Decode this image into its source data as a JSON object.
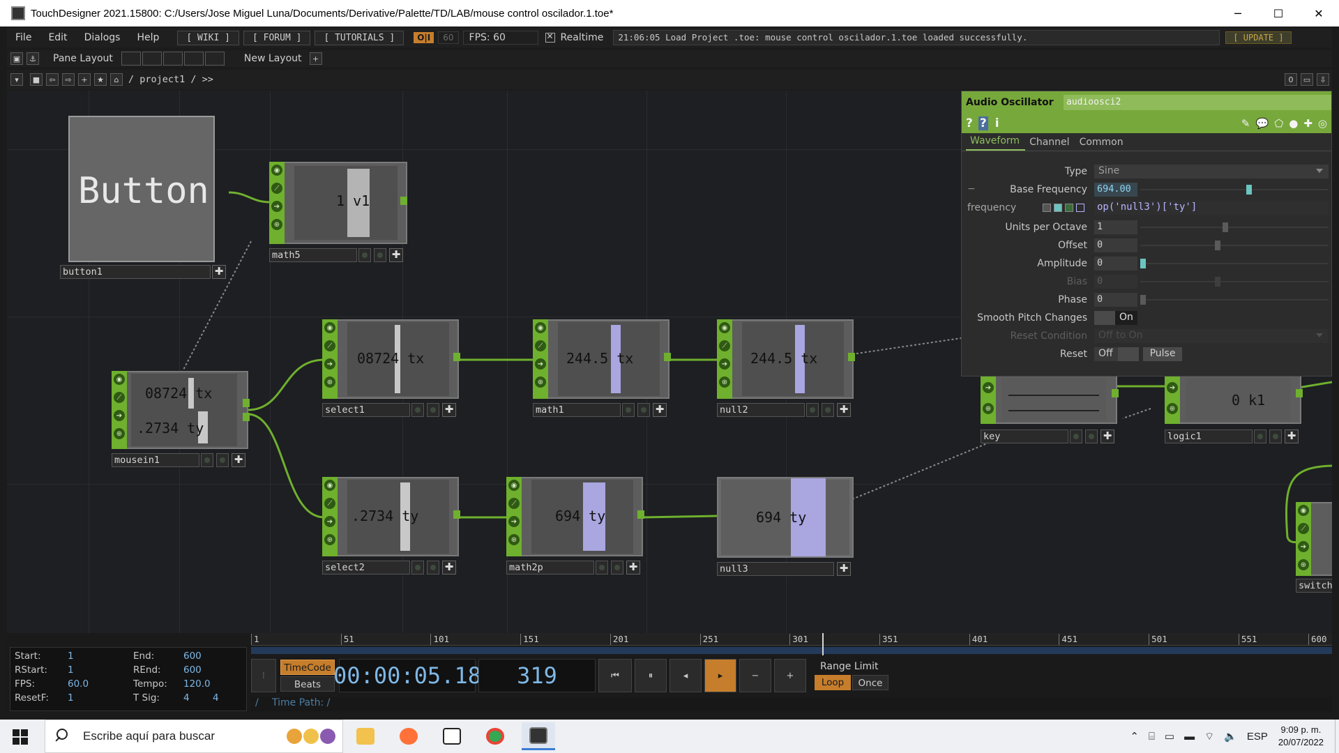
{
  "window": {
    "title": "TouchDesigner 2021.15800: C:/Users/Jose Miguel Luna/Documents/Derivative/Palette/TD/LAB/mouse control oscilador.1.toe*",
    "minimize": "─",
    "maximize": "☐",
    "close": "✕"
  },
  "menubar": {
    "items": [
      "File",
      "Edit",
      "Dialogs",
      "Help"
    ],
    "wiki": "[ WIKI ]",
    "forum": "[ FORUM ]",
    "tutorials": "[ TUTORIALS ]",
    "oi": "O|I",
    "fps_cap": "60",
    "fps": "FPS:  60",
    "realtime": "Realtime",
    "status": "21:06:05 Load Project .toe: mouse control oscilador.1.toe loaded successfully.",
    "update": "[ UPDATE ]"
  },
  "panebar": {
    "pane_layout": "Pane Layout",
    "new_layout": "New Layout",
    "plus": "+"
  },
  "pathbar": {
    "path": "/ project1 / >>",
    "counter": "0"
  },
  "nodes": {
    "button1": {
      "name": "button1",
      "label": "Button"
    },
    "math5": {
      "name": "math5",
      "value": "1 v1"
    },
    "mousein1": {
      "name": "mousein1",
      "value_tx": "08724 tx",
      "value_ty": ".2734 ty"
    },
    "select1": {
      "name": "select1",
      "value": "08724 tx"
    },
    "math1": {
      "name": "math1",
      "value": "244.5 tx"
    },
    "null2": {
      "name": "null2",
      "value": "244.5 tx"
    },
    "select2": {
      "name": "select2",
      "value": ".2734 ty"
    },
    "math2p": {
      "name": "math2p",
      "value": "694 ty"
    },
    "null3": {
      "name": "null3",
      "value": "694 ty"
    },
    "key": {
      "name": "key"
    },
    "logic1": {
      "name": "logic1",
      "value": "0 k1"
    },
    "switch": {
      "name": "switch"
    }
  },
  "params": {
    "op_type": "Audio Oscillator",
    "op_name": "audioosci2",
    "tabs": [
      "Waveform",
      "Channel",
      "Common"
    ],
    "active_tab": "Waveform",
    "rows": {
      "type": {
        "label": "Type",
        "value": "Sine"
      },
      "base_frequency": {
        "label": "Base Frequency",
        "value": "694.00",
        "level": 0.58
      },
      "frequency": {
        "label": "frequency",
        "expr": "op('null3')['ty']"
      },
      "units_per_octave": {
        "label": "Units per Octave",
        "value": "1",
        "level": 0.45
      },
      "offset": {
        "label": "Offset",
        "value": "0",
        "level": 0.41
      },
      "amplitude": {
        "label": "Amplitude",
        "value": "0",
        "level": 0.0
      },
      "bias": {
        "label": "Bias",
        "value": "0",
        "level": 0.41
      },
      "phase": {
        "label": "Phase",
        "value": "0",
        "level": 0.0
      },
      "smooth_pitch": {
        "label": "Smooth Pitch Changes",
        "value": "On"
      },
      "reset_condition": {
        "label": "Reset Condition",
        "value": "Off to On"
      },
      "reset": {
        "label": "Reset",
        "value": "Off",
        "pulse": "Pulse"
      }
    }
  },
  "timeline": {
    "ticks": [
      "1",
      "51",
      "101",
      "151",
      "201",
      "251",
      "301",
      "351",
      "401",
      "451",
      "501",
      "551",
      "600"
    ],
    "current_frame": 319,
    "info": {
      "start_k": "Start:",
      "start_v": "1",
      "end_k": "End:",
      "end_v": "600",
      "rstart_k": "RStart:",
      "rstart_v": "1",
      "rend_k": "REnd:",
      "rend_v": "600",
      "fps_k": "FPS:",
      "fps_v": "60.0",
      "tempo_k": "Tempo:",
      "tempo_v": "120.0",
      "resetf_k": "ResetF:",
      "resetf_v": "1",
      "tsig_k": "T Sig:",
      "tsig_v1": "4",
      "tsig_v2": "4"
    },
    "timecode_btn": "TimeCode",
    "beats_btn": "Beats",
    "timecode": "00:00:05.18",
    "frame": "319",
    "range_limit": "Range Limit",
    "loop": "Loop",
    "once": "Once",
    "time_path": "Time Path: /"
  },
  "taskbar": {
    "search_placeholder": "Escribe aquí para buscar",
    "tray_lang": "ESP",
    "time": "9:09 p. m.",
    "date": "20/07/2022"
  }
}
